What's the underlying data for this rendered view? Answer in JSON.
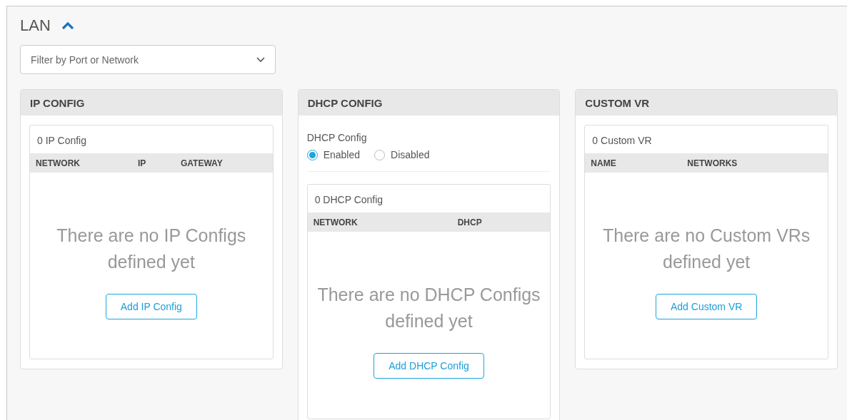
{
  "section": {
    "title": "LAN",
    "expanded": true
  },
  "filter": {
    "placeholder": "Filter by Port or Network"
  },
  "cards": [
    {
      "kind": "table",
      "title": "IP CONFIG",
      "count": "0 IP Config",
      "columns": [
        "NETWORK",
        "IP",
        "GATEWAY"
      ],
      "empty_message": "There are no IP Configs defined yet",
      "button": "Add IP Config"
    },
    {
      "kind": "dhcp",
      "title": "DHCP CONFIG",
      "field_label": "DHCP Config",
      "options": [
        {
          "label": "Enabled",
          "selected": true
        },
        {
          "label": "Disabled",
          "selected": false
        }
      ],
      "count": "0 DHCP Config",
      "columns": [
        "NETWORK",
        "DHCP"
      ],
      "empty_message": "There are no DHCP Configs defined yet",
      "button": "Add DHCP Config"
    },
    {
      "kind": "table",
      "title": "CUSTOM VR",
      "count": "0 Custom VR",
      "columns": [
        "NAME",
        "NETWORKS"
      ],
      "empty_message": "There are no Custom VRs defined yet",
      "button": "Add Custom VR"
    }
  ]
}
